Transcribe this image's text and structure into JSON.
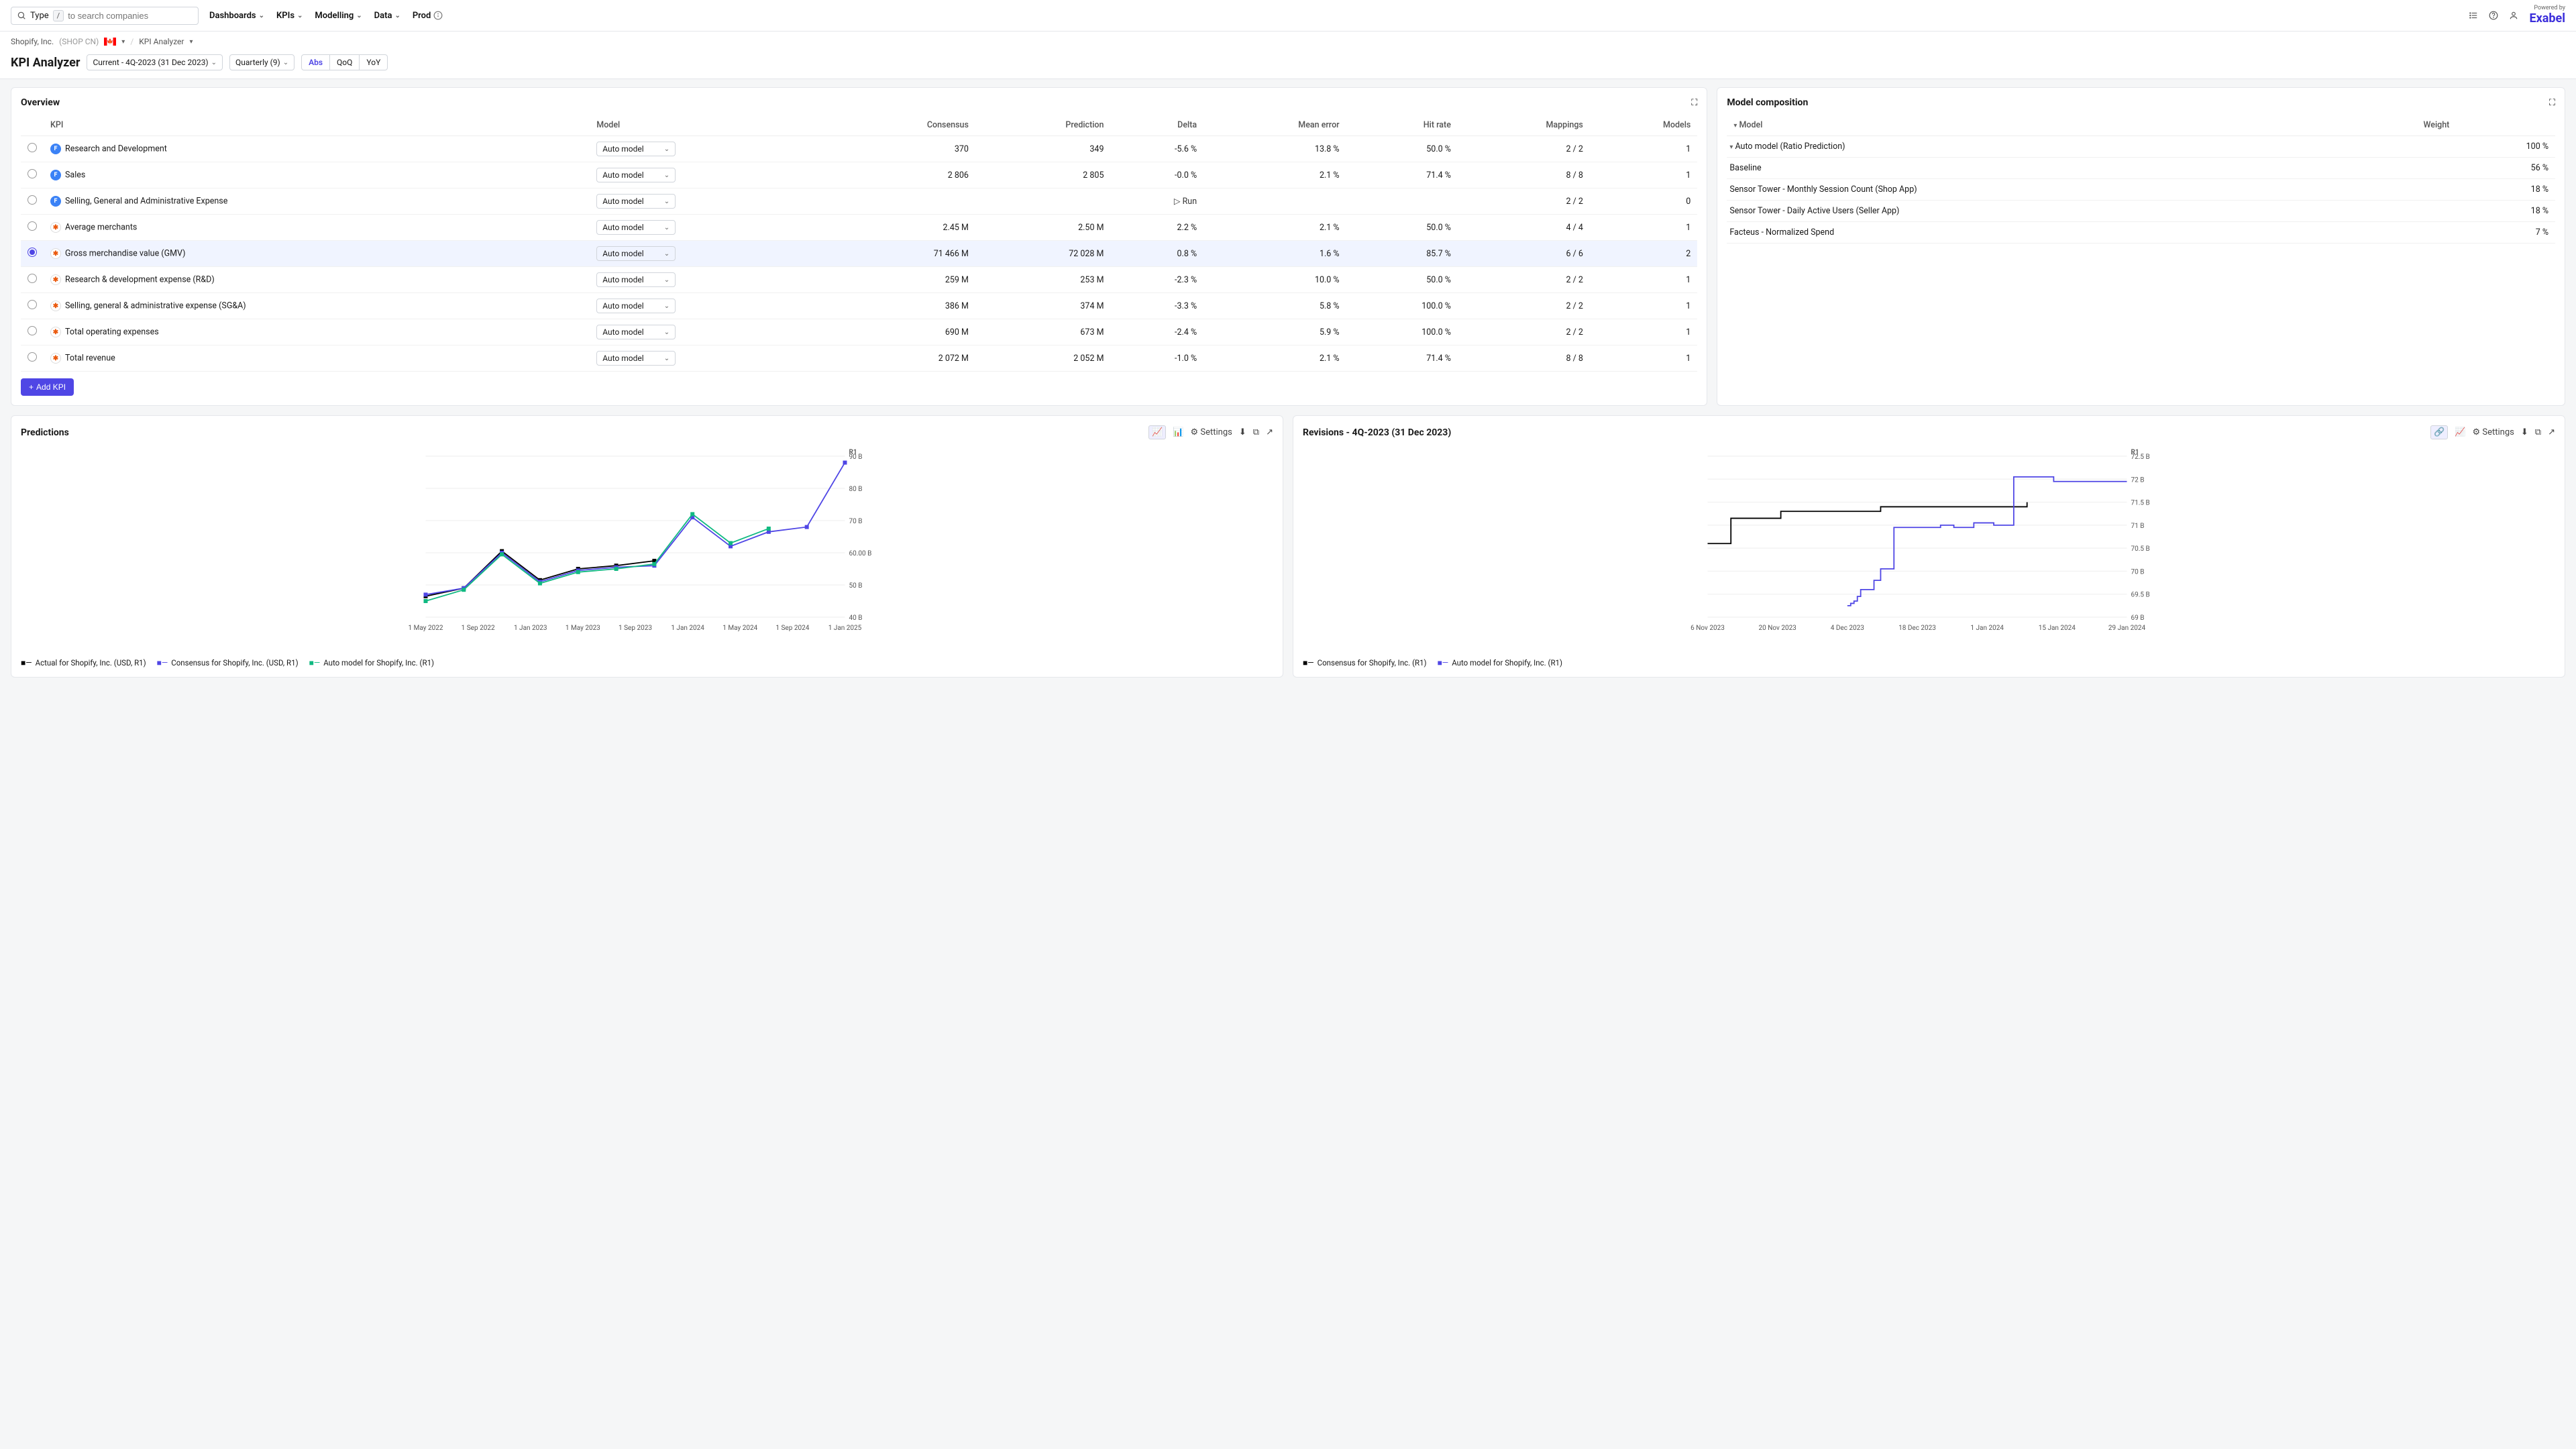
{
  "search": {
    "type_label": "Type",
    "placeholder": "to search companies",
    "kbd": "/"
  },
  "nav": [
    "Dashboards",
    "KPIs",
    "Modelling",
    "Data",
    "Prod"
  ],
  "logo": {
    "brand": "Exabel",
    "powered": "Powered by"
  },
  "breadcrumb": {
    "company": "Shopify, Inc.",
    "ticker": "(SHOP CN)",
    "page": "KPI Analyzer"
  },
  "header": {
    "title": "KPI Analyzer",
    "current": "Current - 4Q-2023 (31 Dec 2023)",
    "period": "Quarterly (9)",
    "toggles": [
      "Abs",
      "QoQ",
      "YoY"
    ],
    "active_toggle": "Abs"
  },
  "overview": {
    "title": "Overview",
    "columns": [
      "KPI",
      "Model",
      "Consensus",
      "Prediction",
      "Delta",
      "Mean error",
      "Hit rate",
      "Mappings",
      "Models"
    ],
    "model_option": "Auto model",
    "run_label": "Run",
    "add_kpi": "Add KPI",
    "rows": [
      {
        "icon": "blue",
        "label": "Research and Development",
        "consensus": "370",
        "prediction": "349",
        "delta": "-5.6 %",
        "mean": "13.8 %",
        "hit": "50.0 %",
        "map": "2 / 2",
        "models": "1"
      },
      {
        "icon": "blue",
        "label": "Sales",
        "consensus": "2 806",
        "prediction": "2 805",
        "delta": "-0.0 %",
        "mean": "2.1 %",
        "hit": "71.4 %",
        "map": "8 / 8",
        "models": "1"
      },
      {
        "icon": "blue",
        "label": "Selling, General and Administrative Expense",
        "run": true,
        "map": "2 / 2",
        "models": "0"
      },
      {
        "icon": "orange",
        "label": "Average merchants",
        "consensus": "2.45 M",
        "prediction": "2.50 M",
        "delta": "2.2 %",
        "mean": "2.1 %",
        "hit": "50.0 %",
        "map": "4 / 4",
        "models": "1"
      },
      {
        "icon": "orange",
        "label": "Gross merchandise value (GMV)",
        "selected": true,
        "consensus": "71 466 M",
        "prediction": "72 028 M",
        "delta": "0.8 %",
        "mean": "1.6 %",
        "hit": "85.7 %",
        "map": "6 / 6",
        "models": "2"
      },
      {
        "icon": "orange",
        "label": "Research & development expense (R&D)",
        "consensus": "259 M",
        "prediction": "253 M",
        "delta": "-2.3 %",
        "mean": "10.0 %",
        "hit": "50.0 %",
        "map": "2 / 2",
        "models": "1"
      },
      {
        "icon": "orange",
        "label": "Selling, general & administrative expense (SG&A)",
        "consensus": "386 M",
        "prediction": "374 M",
        "delta": "-3.3 %",
        "mean": "5.8 %",
        "hit": "100.0 %",
        "map": "2 / 2",
        "models": "1"
      },
      {
        "icon": "orange",
        "label": "Total operating expenses",
        "consensus": "690 M",
        "prediction": "673 M",
        "delta": "-2.4 %",
        "mean": "5.9 %",
        "hit": "100.0 %",
        "map": "2 / 2",
        "models": "1"
      },
      {
        "icon": "orange",
        "label": "Total revenue",
        "consensus": "2 072 M",
        "prediction": "2 052 M",
        "delta": "-1.0 %",
        "mean": "2.1 %",
        "hit": "71.4 %",
        "map": "8 / 8",
        "models": "1"
      }
    ]
  },
  "composition": {
    "title": "Model composition",
    "cols": [
      "Model",
      "Weight"
    ],
    "rows": [
      {
        "label": "Auto model (Ratio Prediction)",
        "weight": "100 %",
        "level": 0,
        "caret": true
      },
      {
        "label": "Baseline",
        "weight": "56 %",
        "level": 1
      },
      {
        "label": "Sensor Tower - Monthly Session Count (Shop App)",
        "weight": "18 %",
        "level": 1
      },
      {
        "label": "Sensor Tower - Daily Active Users (Seller App)",
        "weight": "18 %",
        "level": 1
      },
      {
        "label": "Facteus - Normalized Spend",
        "weight": "7 %",
        "level": 1
      }
    ]
  },
  "predictions": {
    "title": "Predictions",
    "settings": "Settings",
    "legend": [
      {
        "label": "Actual for Shopify, Inc. (USD, R1)",
        "color": "#000"
      },
      {
        "label": "Consensus for Shopify, Inc. (USD, R1)",
        "color": "#4f46e5"
      },
      {
        "label": "Auto model for Shopify, Inc. (R1)",
        "color": "#10b981"
      }
    ]
  },
  "revisions": {
    "title": "Revisions - 4Q-2023 (31 Dec 2023)",
    "settings": "Settings",
    "legend": [
      {
        "label": "Consensus for Shopify, Inc. (R1)",
        "color": "#000"
      },
      {
        "label": "Auto model for Shopify, Inc. (R1)",
        "color": "#4f46e5"
      }
    ]
  },
  "chart_data": [
    {
      "type": "line",
      "title": "Predictions",
      "xlabel": "",
      "ylabel": "",
      "y_axis_label": "R1",
      "ylim": [
        40,
        90
      ],
      "y_unit": "B",
      "x_ticks": [
        "1 May 2022",
        "1 Sep 2022",
        "1 Jan 2023",
        "1 May 2023",
        "1 Sep 2023",
        "1 Jan 2024",
        "1 May 2024",
        "1 Sep 2024",
        "1 Jan 2025"
      ],
      "y_ticks": [
        "90 B",
        "80 B",
        "70 B",
        "60.00 B",
        "50 B",
        "40 B"
      ],
      "series": [
        {
          "name": "Actual for Shopify, Inc. (USD, R1)",
          "color": "#000",
          "x": [
            0,
            1,
            2,
            3,
            4,
            5,
            6
          ],
          "y": [
            46.5,
            49,
            60.5,
            51.5,
            55,
            56,
            57.5
          ]
        },
        {
          "name": "Consensus for Shopify, Inc. (USD, R1)",
          "color": "#4f46e5",
          "x": [
            0,
            1,
            2,
            3,
            4,
            5,
            6,
            7,
            8,
            9,
            10,
            11
          ],
          "y": [
            47,
            49,
            60,
            51,
            54.5,
            55.5,
            56,
            71,
            62,
            66.5,
            68,
            88
          ]
        },
        {
          "name": "Auto model for Shopify, Inc. (R1)",
          "color": "#10b981",
          "x": [
            0,
            1,
            2,
            3,
            4,
            5,
            6,
            7,
            8,
            9
          ],
          "y": [
            45,
            48.5,
            59.5,
            50.5,
            54,
            55,
            56.5,
            72,
            63,
            67.5
          ]
        }
      ]
    },
    {
      "type": "line",
      "title": "Revisions - 4Q-2023 (31 Dec 2023)",
      "xlabel": "",
      "ylabel": "",
      "y_axis_label": "R1",
      "ylim": [
        69,
        72.5
      ],
      "y_unit": "B",
      "x_ticks": [
        "6 Nov 2023",
        "20 Nov 2023",
        "4 Dec 2023",
        "18 Dec 2023",
        "1 Jan 2024",
        "15 Jan 2024",
        "29 Jan 2024"
      ],
      "y_ticks": [
        "72.5 B",
        "72 B",
        "71.5 B",
        "71 B",
        "70.5 B",
        "70 B",
        "69.5 B",
        "69 B"
      ],
      "series": [
        {
          "name": "Consensus for Shopify, Inc. (R1)",
          "color": "#000",
          "step": true,
          "x": [
            0,
            0.3,
            0.35,
            1.1,
            1.1,
            2.6,
            2.6,
            4.8,
            4.8
          ],
          "y": [
            70.6,
            70.6,
            71.15,
            71.15,
            71.3,
            71.3,
            71.4,
            71.4,
            71.5
          ]
        },
        {
          "name": "Auto model for Shopify, Inc. (R1)",
          "color": "#4f46e5",
          "step": true,
          "x": [
            2.1,
            2.15,
            2.2,
            2.25,
            2.3,
            2.5,
            2.6,
            2.8,
            2.8,
            3.5,
            3.7,
            4.0,
            4.3,
            4.6,
            4.6,
            5.2,
            5.2,
            6.3
          ],
          "y": [
            69.25,
            69.3,
            69.35,
            69.45,
            69.6,
            69.8,
            70.05,
            70.95,
            70.95,
            71.0,
            70.95,
            71.05,
            71.0,
            71.05,
            72.05,
            72.05,
            71.95,
            71.95
          ]
        }
      ]
    }
  ]
}
